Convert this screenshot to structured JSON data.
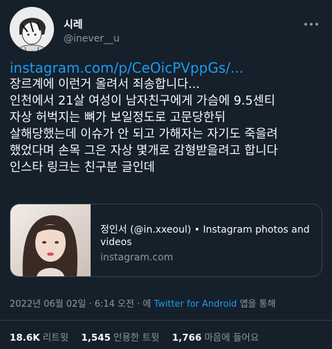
{
  "author": {
    "display_name": "시레",
    "handle": "@inever__u",
    "avatar_icon": "avatar-illustration"
  },
  "tweet": {
    "link": "instagram.com/p/CeOicPVppGs/...",
    "lines": [
      "장르계에 이런거 올려서 죄송합니다...",
      "인천에서 21살 여성이 남자친구에게 가슴에 9.5센티",
      "자상 허벅지는 뼈가 보일정도로 고문당한뒤",
      "살해당했는데 이슈가 안 되고 가해자는 자기도 죽을려",
      "했었다며 손목 그은 자상 몇개로 감형받을려고 합니다",
      "인스타 링크는 친구분 글인데"
    ]
  },
  "card": {
    "title": "정인서 (@in.xxeoul) • Instagram photos and videos",
    "domain": "instagram.com"
  },
  "meta": {
    "timestamp": "2022년 06월 02일 · 6:14 오전 · 에",
    "app": "Twitter for Android",
    "via": "앱을 통해"
  },
  "stats": {
    "retweets_count": "18.6K",
    "retweets_label": "리트윗",
    "quotes_count": "1,545",
    "quotes_label": "인용한 트윗",
    "likes_count": "1,766",
    "likes_label": "마음에 들어요"
  },
  "colors": {
    "background": "#15202b",
    "link": "#1d9bf0",
    "secondary": "#8b98a5",
    "border": "#38444d"
  }
}
